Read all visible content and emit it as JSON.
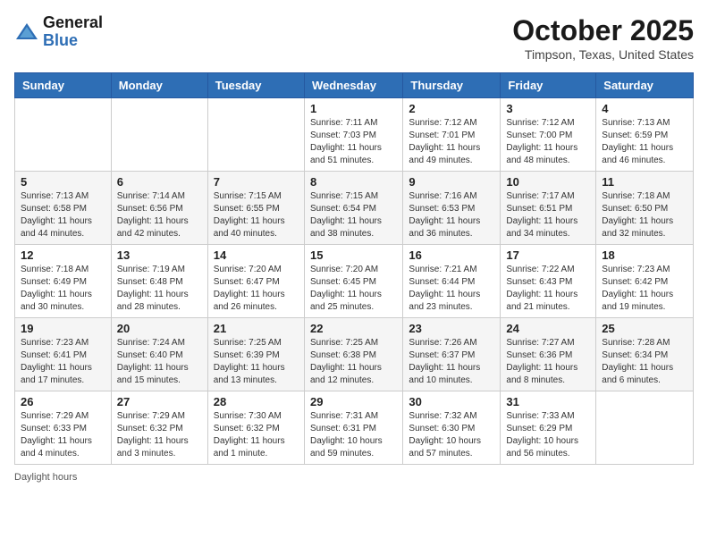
{
  "header": {
    "logo_general": "General",
    "logo_blue": "Blue",
    "month": "October 2025",
    "location": "Timpson, Texas, United States"
  },
  "weekdays": [
    "Sunday",
    "Monday",
    "Tuesday",
    "Wednesday",
    "Thursday",
    "Friday",
    "Saturday"
  ],
  "weeks": [
    [
      {
        "day": "",
        "info": ""
      },
      {
        "day": "",
        "info": ""
      },
      {
        "day": "",
        "info": ""
      },
      {
        "day": "1",
        "info": "Sunrise: 7:11 AM\nSunset: 7:03 PM\nDaylight: 11 hours and 51 minutes."
      },
      {
        "day": "2",
        "info": "Sunrise: 7:12 AM\nSunset: 7:01 PM\nDaylight: 11 hours and 49 minutes."
      },
      {
        "day": "3",
        "info": "Sunrise: 7:12 AM\nSunset: 7:00 PM\nDaylight: 11 hours and 48 minutes."
      },
      {
        "day": "4",
        "info": "Sunrise: 7:13 AM\nSunset: 6:59 PM\nDaylight: 11 hours and 46 minutes."
      }
    ],
    [
      {
        "day": "5",
        "info": "Sunrise: 7:13 AM\nSunset: 6:58 PM\nDaylight: 11 hours and 44 minutes."
      },
      {
        "day": "6",
        "info": "Sunrise: 7:14 AM\nSunset: 6:56 PM\nDaylight: 11 hours and 42 minutes."
      },
      {
        "day": "7",
        "info": "Sunrise: 7:15 AM\nSunset: 6:55 PM\nDaylight: 11 hours and 40 minutes."
      },
      {
        "day": "8",
        "info": "Sunrise: 7:15 AM\nSunset: 6:54 PM\nDaylight: 11 hours and 38 minutes."
      },
      {
        "day": "9",
        "info": "Sunrise: 7:16 AM\nSunset: 6:53 PM\nDaylight: 11 hours and 36 minutes."
      },
      {
        "day": "10",
        "info": "Sunrise: 7:17 AM\nSunset: 6:51 PM\nDaylight: 11 hours and 34 minutes."
      },
      {
        "day": "11",
        "info": "Sunrise: 7:18 AM\nSunset: 6:50 PM\nDaylight: 11 hours and 32 minutes."
      }
    ],
    [
      {
        "day": "12",
        "info": "Sunrise: 7:18 AM\nSunset: 6:49 PM\nDaylight: 11 hours and 30 minutes."
      },
      {
        "day": "13",
        "info": "Sunrise: 7:19 AM\nSunset: 6:48 PM\nDaylight: 11 hours and 28 minutes."
      },
      {
        "day": "14",
        "info": "Sunrise: 7:20 AM\nSunset: 6:47 PM\nDaylight: 11 hours and 26 minutes."
      },
      {
        "day": "15",
        "info": "Sunrise: 7:20 AM\nSunset: 6:45 PM\nDaylight: 11 hours and 25 minutes."
      },
      {
        "day": "16",
        "info": "Sunrise: 7:21 AM\nSunset: 6:44 PM\nDaylight: 11 hours and 23 minutes."
      },
      {
        "day": "17",
        "info": "Sunrise: 7:22 AM\nSunset: 6:43 PM\nDaylight: 11 hours and 21 minutes."
      },
      {
        "day": "18",
        "info": "Sunrise: 7:23 AM\nSunset: 6:42 PM\nDaylight: 11 hours and 19 minutes."
      }
    ],
    [
      {
        "day": "19",
        "info": "Sunrise: 7:23 AM\nSunset: 6:41 PM\nDaylight: 11 hours and 17 minutes."
      },
      {
        "day": "20",
        "info": "Sunrise: 7:24 AM\nSunset: 6:40 PM\nDaylight: 11 hours and 15 minutes."
      },
      {
        "day": "21",
        "info": "Sunrise: 7:25 AM\nSunset: 6:39 PM\nDaylight: 11 hours and 13 minutes."
      },
      {
        "day": "22",
        "info": "Sunrise: 7:25 AM\nSunset: 6:38 PM\nDaylight: 11 hours and 12 minutes."
      },
      {
        "day": "23",
        "info": "Sunrise: 7:26 AM\nSunset: 6:37 PM\nDaylight: 11 hours and 10 minutes."
      },
      {
        "day": "24",
        "info": "Sunrise: 7:27 AM\nSunset: 6:36 PM\nDaylight: 11 hours and 8 minutes."
      },
      {
        "day": "25",
        "info": "Sunrise: 7:28 AM\nSunset: 6:34 PM\nDaylight: 11 hours and 6 minutes."
      }
    ],
    [
      {
        "day": "26",
        "info": "Sunrise: 7:29 AM\nSunset: 6:33 PM\nDaylight: 11 hours and 4 minutes."
      },
      {
        "day": "27",
        "info": "Sunrise: 7:29 AM\nSunset: 6:32 PM\nDaylight: 11 hours and 3 minutes."
      },
      {
        "day": "28",
        "info": "Sunrise: 7:30 AM\nSunset: 6:32 PM\nDaylight: 11 hours and 1 minute."
      },
      {
        "day": "29",
        "info": "Sunrise: 7:31 AM\nSunset: 6:31 PM\nDaylight: 10 hours and 59 minutes."
      },
      {
        "day": "30",
        "info": "Sunrise: 7:32 AM\nSunset: 6:30 PM\nDaylight: 10 hours and 57 minutes."
      },
      {
        "day": "31",
        "info": "Sunrise: 7:33 AM\nSunset: 6:29 PM\nDaylight: 10 hours and 56 minutes."
      },
      {
        "day": "",
        "info": ""
      }
    ]
  ],
  "footer": {
    "daylight_hours": "Daylight hours"
  }
}
